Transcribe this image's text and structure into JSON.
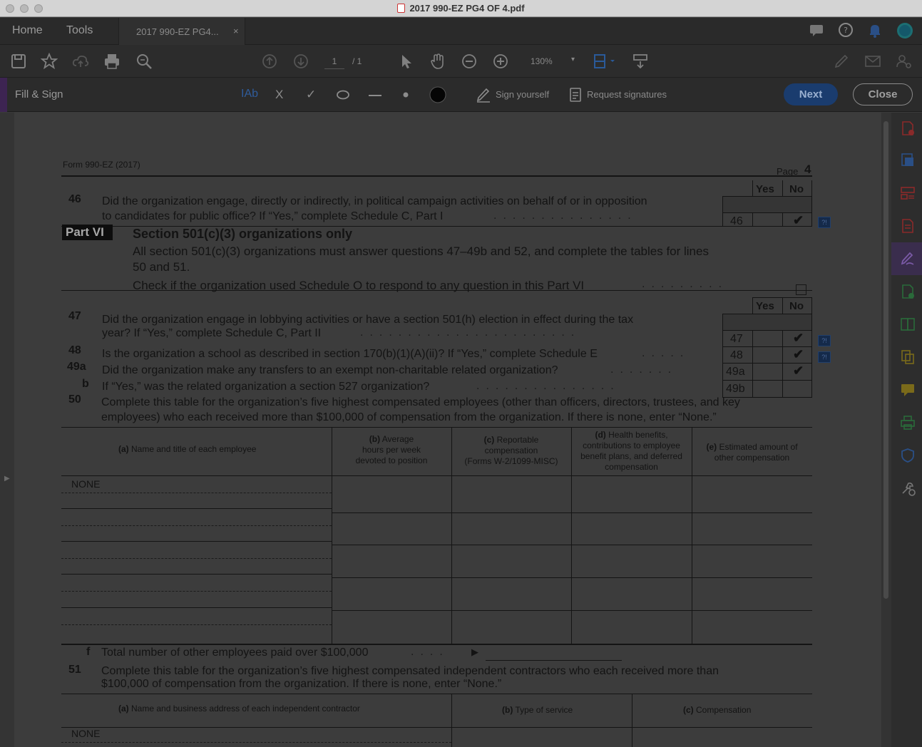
{
  "window": {
    "title": "2017 990-EZ PG4 OF 4.pdf"
  },
  "tabs": {
    "home": "Home",
    "tools": "Tools",
    "doc_tab": "2017 990-EZ PG4...",
    "close_glyph": "×"
  },
  "toolbar": {
    "page_current": "1",
    "page_total": "/ 1",
    "zoom": "130%"
  },
  "fillsign": {
    "title": "Fill & Sign",
    "text_tool": "IAb",
    "cross_tool": "X",
    "check_tool": "✓",
    "sign_yourself": "Sign yourself",
    "request_signatures": "Request signatures",
    "next": "Next",
    "close": "Close"
  },
  "form": {
    "header_left": "Form 990-EZ (2017)",
    "header_page_label": "Page",
    "header_page_num": "4",
    "yes": "Yes",
    "no": "No",
    "q46_num": "46",
    "q46_line1": "Did the organization engage, directly or indirectly, in political campaign activities on behalf of or in opposition",
    "q46_line2": "to candidates for public office? If “Yes,” complete Schedule C, Part I",
    "part6_tag": "Part VI",
    "part6_title": "Section 501(c)(3) organizations only",
    "part6_line1": "All section 501(c)(3) organizations must answer questions 47–49b and 52, and complete the tables for lines",
    "part6_line2": "50 and 51.",
    "part6_line3": "Check if the organization used Schedule O to respond to any question in this Part VI",
    "q47_num": "47",
    "q47_line1": "Did the organization engage in lobbying activities or have a section 501(h) election in effect during the tax",
    "q47_line2": "year? If “Yes,” complete Schedule C, Part II",
    "q48_num": "48",
    "q48_text": "Is the organization a school as described in section 170(b)(1)(A)(ii)? If “Yes,” complete Schedule E",
    "q49a_num": "49a",
    "q49a_text": "Did the organization make any transfers to an exempt non-charitable related organization?",
    "q49b_num": "b",
    "q49b_text": "If “Yes,” was the related organization a section 527 organization?",
    "q50_num": "50",
    "q50_line1": "Complete this table for the organization’s five highest compensated employees (other than officers, directors, trustees, and key",
    "q50_line2": "employees) who each received more than $100,000 of compensation from the organization. If there is none, enter “None.”",
    "box46": "46",
    "box47": "47",
    "box48": "48",
    "box49a": "49a",
    "box49b": "49b",
    "checkmark": "✔",
    "help_glyph": "?!",
    "t50_col_a_tag": "(a)",
    "t50_col_a": "Name and title of each employee",
    "t50_col_b_tag": "(b)",
    "t50_col_b_1": "Average",
    "t50_col_b_2": "hours per week",
    "t50_col_b_3": "devoted to position",
    "t50_col_c_tag": "(c)",
    "t50_col_c_1": "Reportable",
    "t50_col_c_2": "compensation",
    "t50_col_c_3": "(Forms W-2/1099-MISC)",
    "t50_col_d_tag": "(d)",
    "t50_col_d_1": "Health benefits,",
    "t50_col_d_2": "contributions to employee",
    "t50_col_d_3": "benefit plans, and deferred",
    "t50_col_d_4": "compensation",
    "t50_col_e_tag": "(e)",
    "t50_col_e_1": "Estimated amount of",
    "t50_col_e_2": "other compensation",
    "t50_row1_name": "NONE",
    "f_num": "f",
    "f_text": "Total number of other employees paid over $100,000",
    "arrow": "▶",
    "q51_num": "51",
    "q51_line1": "Complete this table for the organization’s five highest compensated independent contractors who each received more than",
    "q51_line2": "$100,000 of  compensation from the organization. If there is none, enter “None.”",
    "t51_col_a_tag": "(a)",
    "t51_col_a": "Name and business address of each independent contractor",
    "t51_col_b_tag": "(b)",
    "t51_col_b": "Type of service",
    "t51_col_c_tag": "(c)",
    "t51_col_c": "Compensation",
    "t51_row1_name": "NONE"
  }
}
